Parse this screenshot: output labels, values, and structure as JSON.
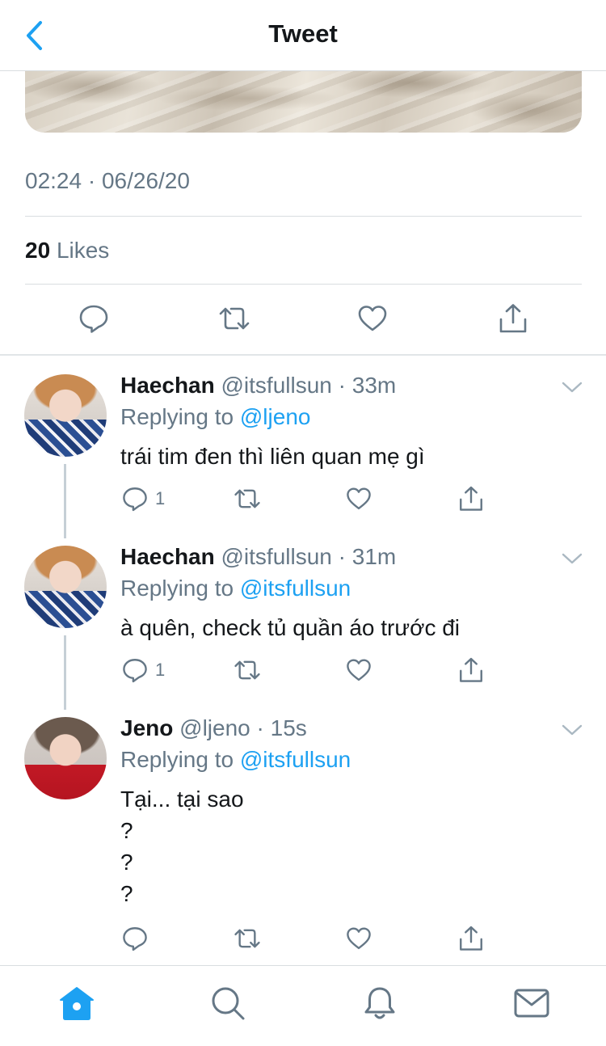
{
  "header": {
    "title": "Tweet"
  },
  "tweet": {
    "timestamp": "02:24 · 06/26/20",
    "likes_count": "20",
    "likes_label": "Likes"
  },
  "replies": [
    {
      "name": "Haechan",
      "handle": "@itsfullsun",
      "time": "· 33m",
      "replying_prefix": "Replying to",
      "replying_to": "@ljeno",
      "text_lines": [
        "trái tim đen thì liên quan mẹ gì"
      ],
      "reply_count": "1"
    },
    {
      "name": "Haechan",
      "handle": "@itsfullsun",
      "time": "· 31m",
      "replying_prefix": "Replying to",
      "replying_to": "@itsfullsun",
      "text_lines": [
        "à quên, check tủ quần áo trước đi"
      ],
      "reply_count": "1"
    },
    {
      "name": "Jeno",
      "handle": "@ljeno",
      "time": "· 15s",
      "replying_prefix": "Replying to",
      "replying_to": "@itsfullsun",
      "text_lines": [
        "Tại... tại sao",
        "?",
        "?",
        "?"
      ],
      "reply_count": ""
    }
  ],
  "colors": {
    "accent": "#1da1f2",
    "secondary_text": "#657786",
    "icon_gray": "#657786"
  },
  "icons": {
    "back": "chevron-left-icon",
    "reply": "speech-bubble-icon",
    "retweet": "retweet-icon",
    "like": "heart-icon",
    "share": "share-icon",
    "caret": "chevron-down-icon",
    "tabs": [
      "home-icon",
      "search-icon",
      "bell-icon",
      "mail-icon"
    ]
  }
}
